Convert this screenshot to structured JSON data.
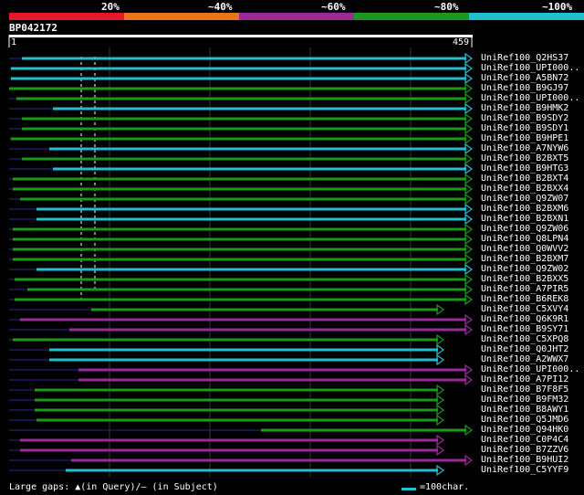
{
  "legend": {
    "segments": [
      {
        "color": "#e8172c"
      },
      {
        "color": "#e8741a"
      },
      {
        "color": "#9a2a98"
      },
      {
        "color": "#1a9a1a"
      },
      {
        "color": "#22bfd0"
      }
    ],
    "pcts": [
      "20%",
      "~40%",
      "~60%",
      "~80%",
      "~100%"
    ]
  },
  "query": {
    "id": "BP042172",
    "start": "1",
    "end": "459"
  },
  "colors": {
    "cyan": "#22bfd0",
    "green": "#1a9a1a",
    "purple": "#9a2a98",
    "grid": "#333333"
  },
  "hits": [
    {
      "label": "UniRef100_Q2HS37",
      "color": "cyan",
      "s": 24,
      "e": 517
    },
    {
      "label": "UniRef100_UPI000..",
      "color": "cyan",
      "s": 12,
      "e": 517
    },
    {
      "label": "UniRef100_A5BN72",
      "color": "cyan",
      "s": 12,
      "e": 517
    },
    {
      "label": "UniRef100_B9GJ97",
      "color": "green",
      "s": 10,
      "e": 517
    },
    {
      "label": "UniRef100_UPI000..",
      "color": "green",
      "s": 18,
      "e": 517
    },
    {
      "label": "UniRef100_B9HMK2",
      "color": "cyan",
      "s": 58,
      "e": 517
    },
    {
      "label": "UniRef100_B9SDY2",
      "color": "green",
      "s": 24,
      "e": 517
    },
    {
      "label": "UniRef100_B9SDY1",
      "color": "green",
      "s": 24,
      "e": 517
    },
    {
      "label": "UniRef100_B9HPE1",
      "color": "green",
      "s": 12,
      "e": 517
    },
    {
      "label": "UniRef100_A7NYW6",
      "color": "cyan",
      "s": 54,
      "e": 517
    },
    {
      "label": "UniRef100_B2BXT5",
      "color": "green",
      "s": 24,
      "e": 517
    },
    {
      "label": "UniRef100_B9HTG3",
      "color": "cyan",
      "s": 58,
      "e": 517
    },
    {
      "label": "UniRef100_B2BXT4",
      "color": "green",
      "s": 14,
      "e": 517
    },
    {
      "label": "UniRef100_B2BXX4",
      "color": "green",
      "s": 14,
      "e": 517
    },
    {
      "label": "UniRef100_Q9ZW07",
      "color": "green",
      "s": 22,
      "e": 517
    },
    {
      "label": "UniRef100_B2BXM6",
      "color": "cyan",
      "s": 40,
      "e": 517
    },
    {
      "label": "UniRef100_B2BXN1",
      "color": "cyan",
      "s": 40,
      "e": 517
    },
    {
      "label": "UniRef100_Q9ZW06",
      "color": "green",
      "s": 14,
      "e": 517
    },
    {
      "label": "UniRef100_Q8LPN4",
      "color": "green",
      "s": 14,
      "e": 517
    },
    {
      "label": "UniRef100_Q0WVV2",
      "color": "green",
      "s": 14,
      "e": 517
    },
    {
      "label": "UniRef100_B2BXM7",
      "color": "green",
      "s": 14,
      "e": 517
    },
    {
      "label": "UniRef100_Q9ZW02",
      "color": "cyan",
      "s": 40,
      "e": 517
    },
    {
      "label": "UniRef100_B2BXX5",
      "color": "green",
      "s": 16,
      "e": 517
    },
    {
      "label": "UniRef100_A7PIR5",
      "color": "green",
      "s": 30,
      "e": 517
    },
    {
      "label": "UniRef100_B6REK8",
      "color": "green",
      "s": 16,
      "e": 517
    },
    {
      "label": "UniRef100_C5XVY4",
      "color": "green",
      "s": 100,
      "e": 486
    },
    {
      "label": "UniRef100_Q6K9R1",
      "color": "purple",
      "s": 22,
      "e": 517
    },
    {
      "label": "UniRef100_B9SY71",
      "color": "purple",
      "s": 76,
      "e": 517
    },
    {
      "label": "UniRef100_C5XPQ8",
      "color": "green",
      "s": 14,
      "e": 486
    },
    {
      "label": "UniRef100_Q0JHT2",
      "color": "cyan",
      "s": 54,
      "e": 486
    },
    {
      "label": "UniRef100_A2WWX7",
      "color": "cyan",
      "s": 54,
      "e": 486
    },
    {
      "label": "UniRef100_UPI000..",
      "color": "purple",
      "s": 86,
      "e": 517
    },
    {
      "label": "UniRef100_A7PI12",
      "color": "purple",
      "s": 86,
      "e": 517
    },
    {
      "label": "UniRef100_B7F8F5",
      "color": "green",
      "s": 38,
      "e": 486
    },
    {
      "label": "UniRef100_B9FM32",
      "color": "green",
      "s": 38,
      "e": 486
    },
    {
      "label": "UniRef100_B8AWY1",
      "color": "green",
      "s": 38,
      "e": 486
    },
    {
      "label": "UniRef100_Q5JMD6",
      "color": "green",
      "s": 40,
      "e": 486
    },
    {
      "label": "UniRef100_Q94HK0",
      "color": "green",
      "s": 286,
      "e": 517
    },
    {
      "label": "UniRef100_C0P4C4",
      "color": "purple",
      "s": 22,
      "e": 486
    },
    {
      "label": "UniRef100_B7ZZV6",
      "color": "purple",
      "s": 22,
      "e": 486
    },
    {
      "label": "UniRef100_B9HUI2",
      "color": "purple",
      "s": 78,
      "e": 517
    },
    {
      "label": "UniRef100_C5YYF9",
      "color": "cyan",
      "s": 72,
      "e": 486
    }
  ],
  "footer": {
    "text": "Large gaps: ▲(in Query)/— (in Subject)",
    "scale": "=100char."
  }
}
